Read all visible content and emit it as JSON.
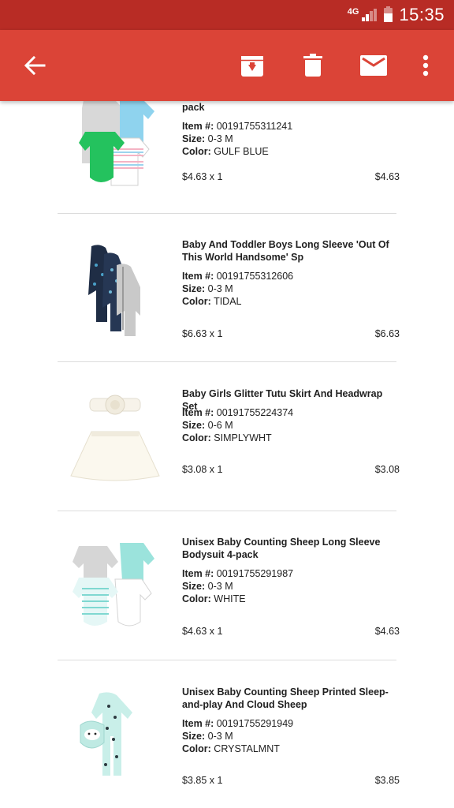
{
  "status_bar": {
    "network": "4G",
    "time": "15:35"
  },
  "toolbar": {
    "icons": [
      "back-arrow-icon",
      "archive-icon",
      "delete-icon",
      "mail-icon",
      "more-vert-icon"
    ]
  },
  "colors": {
    "status_bar": "#b82c25",
    "toolbar": "#db4437"
  },
  "order_items": [
    {
      "name": "pack",
      "item_label": "Item #:",
      "item_number": "00191755311241",
      "size_label": "Size:",
      "size": "0-3 M",
      "color_label": "Color:",
      "color": "GULF BLUE",
      "unit_price": "$4.63 x 1",
      "total": "$4.63"
    },
    {
      "name": "Baby And Toddler Boys Long Sleeve 'Out Of This World Handsome' Sp",
      "item_label": "Item #:",
      "item_number": "00191755312606",
      "size_label": "Size:",
      "size": "0-3 M",
      "color_label": "Color:",
      "color": "TIDAL",
      "unit_price": "$6.63 x 1",
      "total": "$6.63"
    },
    {
      "name": "Baby Girls Glitter Tutu Skirt And Headwrap Set",
      "item_label": "Item #:",
      "item_number": "00191755224374",
      "size_label": "Size:",
      "size": "0-6 M",
      "color_label": "Color:",
      "color": "SIMPLYWHT",
      "unit_price": "$3.08 x 1",
      "total": "$3.08"
    },
    {
      "name": "Unisex Baby Counting Sheep Long Sleeve Bodysuit 4-pack",
      "item_label": "Item #:",
      "item_number": "00191755291987",
      "size_label": "Size:",
      "size": "0-3 M",
      "color_label": "Color:",
      "color": "WHITE",
      "unit_price": "$4.63 x 1",
      "total": "$4.63"
    },
    {
      "name": "Unisex Baby Counting Sheep Printed Sleep-and-play And Cloud Sheep",
      "item_label": "Item #:",
      "item_number": "00191755291949",
      "size_label": "Size:",
      "size": "0-3 M",
      "color_label": "Color:",
      "color": "CRYSTALMNT",
      "unit_price": "$3.85 x 1",
      "total": "$3.85"
    }
  ]
}
